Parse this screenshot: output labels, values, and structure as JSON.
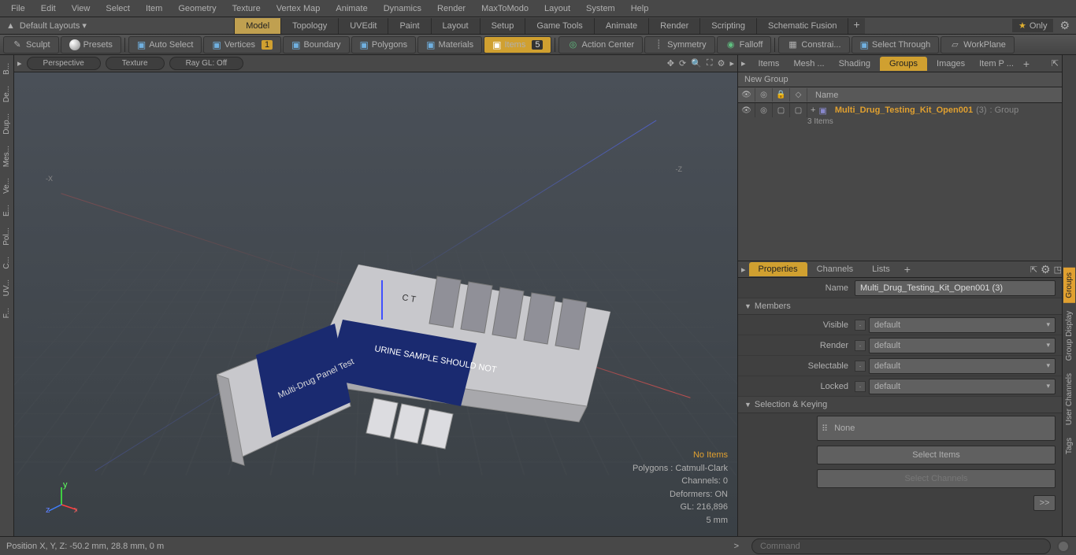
{
  "menus": [
    "File",
    "Edit",
    "View",
    "Select",
    "Item",
    "Geometry",
    "Texture",
    "Vertex Map",
    "Animate",
    "Dynamics",
    "Render",
    "MaxToModo",
    "Layout",
    "System",
    "Help"
  ],
  "layout": {
    "dropdown": "Default Layouts ▾",
    "tabs": [
      "Model",
      "Topology",
      "UVEdit",
      "Paint",
      "Layout",
      "Setup",
      "Game Tools",
      "Animate",
      "Render",
      "Scripting",
      "Schematic Fusion"
    ],
    "active": "Model",
    "only": "Only"
  },
  "toolbar": {
    "sculpt": "Sculpt",
    "presets": "Presets",
    "select": [
      "Auto Select",
      "Vertices",
      "Boundary",
      "Polygons",
      "Materials",
      "Items"
    ],
    "select_active": "Items",
    "vertices_badge": "1",
    "items_badge": "5",
    "action": "Action Center",
    "symmetry": "Symmetry",
    "falloff": "Falloff",
    "constraints": "Constrai...",
    "selthrough": "Select Through",
    "workplane": "WorkPlane"
  },
  "viewport": {
    "tabs": [
      "Perspective",
      "Texture",
      "Ray GL: Off"
    ],
    "axis_x_neg": "-X",
    "axis_z_neg": "-Z",
    "info": {
      "noitems": "No Items",
      "polygons": "Polygons : Catmull-Clark",
      "channels": "Channels: 0",
      "deformers": "Deformers: ON",
      "gl": "GL: 216,896",
      "units": "5 mm"
    },
    "gizmo": {
      "x": "x",
      "y": "y",
      "z": "z"
    }
  },
  "right": {
    "tabs1": [
      "Items",
      "Mesh ...",
      "Shading",
      "Groups",
      "Images",
      "Item P ..."
    ],
    "tabs1_active": "Groups",
    "new_group": "New Group",
    "tree_header_name": "Name",
    "item_name": "Multi_Drug_Testing_Kit_Open001",
    "item_count": "(3)",
    "item_type": ": Group",
    "item_sub": "3 Items",
    "tabs2": [
      "Properties",
      "Channels",
      "Lists"
    ],
    "tabs2_active": "Properties",
    "name_label": "Name",
    "name_value": "Multi_Drug_Testing_Kit_Open001 (3)",
    "section_members": "Members",
    "members": {
      "visible": {
        "label": "Visible",
        "value": "default"
      },
      "render": {
        "label": "Render",
        "value": "default"
      },
      "selectable": {
        "label": "Selectable",
        "value": "default"
      },
      "locked": {
        "label": "Locked",
        "value": "default"
      }
    },
    "section_selkey": "Selection & Keying",
    "none": "None",
    "select_items": "Select Items",
    "select_channels": "Select Channels",
    "double_chev": ">>"
  },
  "rail_left": [
    "B...",
    "De...",
    "Dup...",
    "Mes...",
    "Ve...",
    "E...",
    "Pol...",
    "C...",
    "UV...",
    "F..."
  ],
  "rail_right": [
    "Groups",
    "Group Display",
    "User Channels",
    "Tags"
  ],
  "status": {
    "position": "Position X, Y, Z:   -50.2 mm, 28.8 mm, 0 m",
    "cmd_prompt": ">",
    "cmd_placeholder": "Command"
  }
}
